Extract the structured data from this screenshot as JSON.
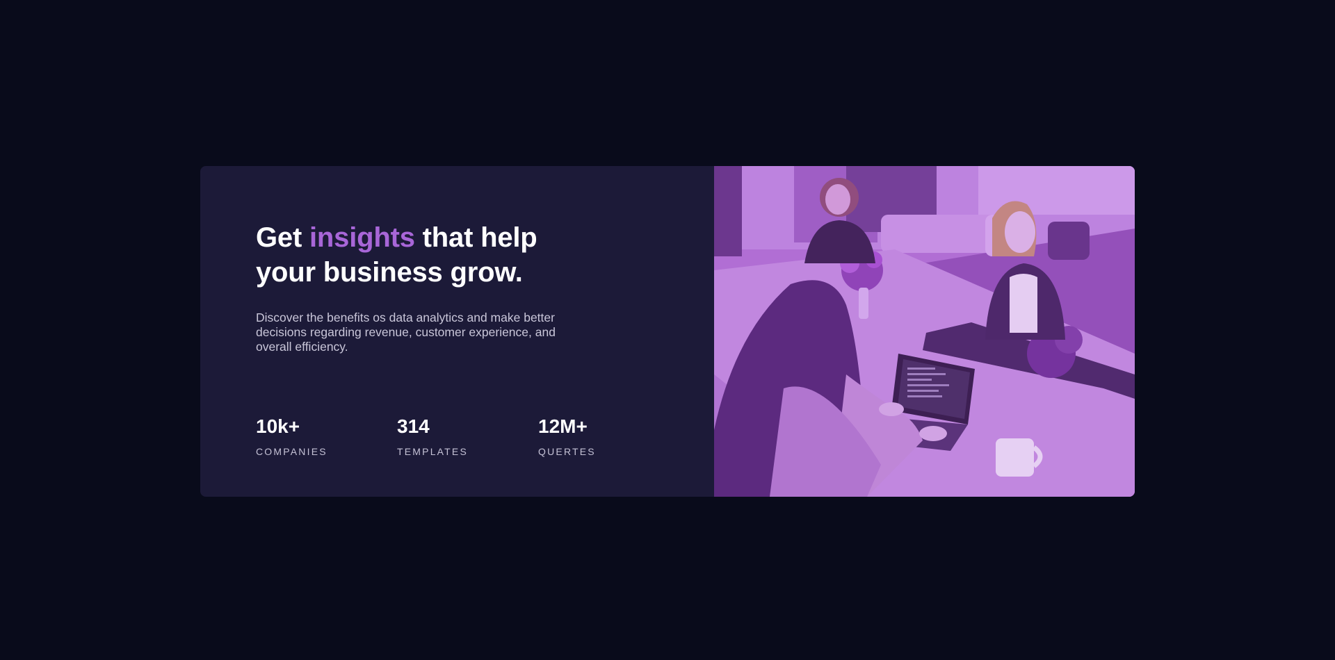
{
  "hero": {
    "headline_part1": "Get ",
    "headline_accent": "insights",
    "headline_part2": " that help your business grow.",
    "description": "Discover the benefits os data analytics and make better decisions regarding revenue, customer experience, and overall efficiency."
  },
  "stats": [
    {
      "value": "10k+",
      "label": "COMPANIES"
    },
    {
      "value": "314",
      "label": "TEMPLATES"
    },
    {
      "value": "12M+",
      "label": "QUERTES"
    }
  ],
  "image": {
    "subject": "office-team-photo"
  },
  "colors": {
    "page_background": "#090b1b",
    "card_background": "#1c1a38",
    "accent": "#a866d8",
    "image_overlay": "#aa5cdb"
  }
}
